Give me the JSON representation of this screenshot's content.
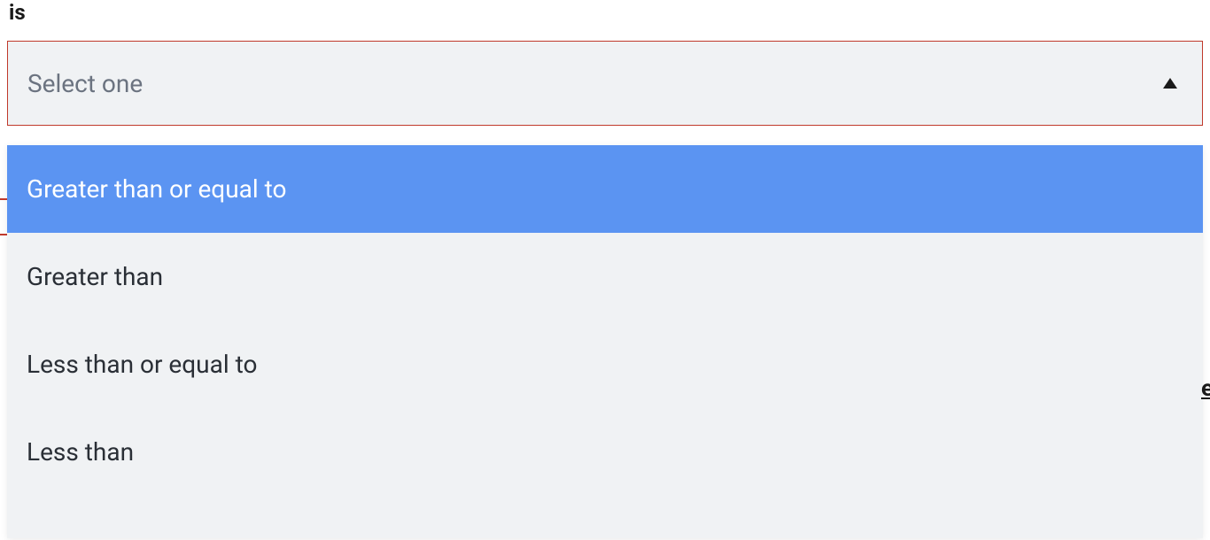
{
  "field": {
    "label": "is",
    "placeholder": "Select one"
  },
  "options": [
    {
      "label": "Greater than or equal to",
      "highlighted": true
    },
    {
      "label": "Greater than",
      "highlighted": false
    },
    {
      "label": "Less than or equal to",
      "highlighted": false
    },
    {
      "label": "Less than",
      "highlighted": false
    }
  ],
  "edge_glyph": "e"
}
